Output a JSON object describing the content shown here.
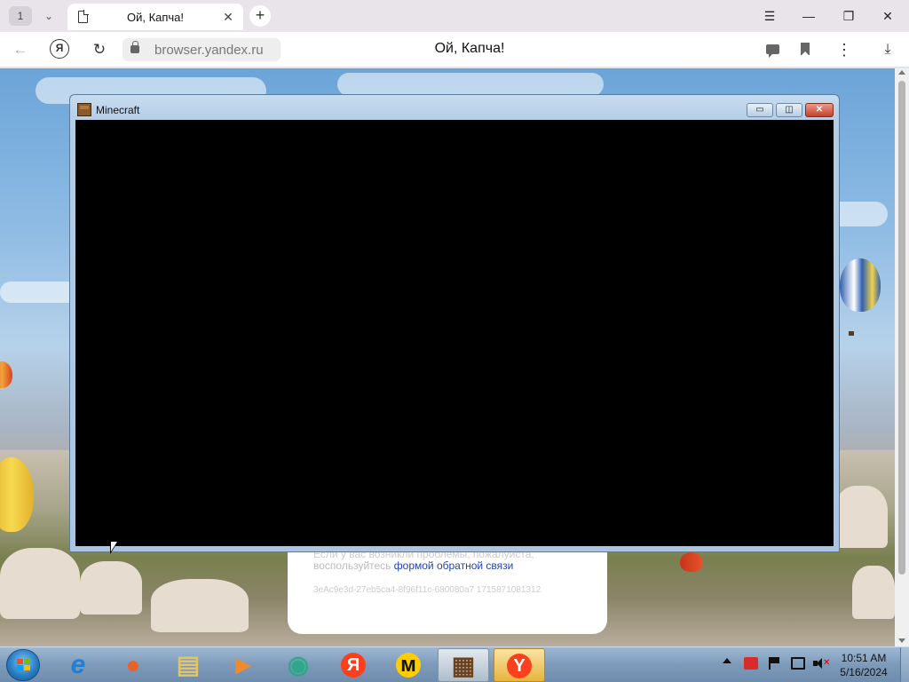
{
  "browser": {
    "tab_counter": "1",
    "tab_title": "Ой, Капча!",
    "url": "browser.yandex.ru",
    "page_title": "Ой, Капча!",
    "window_controls": {
      "menu": "☰",
      "minimize": "—",
      "restore": "❐",
      "close": "✕"
    },
    "nav_glyphs": {
      "back": "←",
      "reload": "↻",
      "yandex": "Я",
      "new_tab": "+",
      "tab_close": "✕",
      "tab_list": "⌄",
      "menu": "⋮",
      "download": "⤓"
    }
  },
  "captcha": {
    "line1_faded": "Если у вас возникли проблемы, пожалуйста,",
    "line2_prefix": "воспользуйтесь",
    "feedback_link": "формой обратной связи",
    "request_id": "3eAc9e3d-27eb5ca4-8f96f11c-680080a7 1715871081312"
  },
  "minecraft_window": {
    "title": "Minecraft",
    "controls": {
      "minimize": "▭",
      "maximize": "◫",
      "close": "✕"
    }
  },
  "taskbar": {
    "apps": [
      {
        "name": "internet-explorer",
        "glyph": "e",
        "color": "#1e7fd6"
      },
      {
        "name": "firefox",
        "glyph": "●",
        "color": "#e8622c"
      },
      {
        "name": "file-explorer",
        "glyph": "▤",
        "color": "#e8c45a"
      },
      {
        "name": "media-player",
        "glyph": "▶",
        "color": "#f08a2a"
      },
      {
        "name": "messenger",
        "glyph": "◉",
        "color": "#2fa88a"
      },
      {
        "name": "yandex",
        "glyph": "Я",
        "color": "#ffffff"
      },
      {
        "name": "yandex-market",
        "glyph": "м",
        "color": "#111111"
      },
      {
        "name": "minecraft-launcher",
        "glyph": "▦",
        "color": "#6b4320"
      },
      {
        "name": "yandex-browser",
        "glyph": "Y",
        "color": "#ffffff"
      }
    ],
    "clock_time": "10:51 AM",
    "clock_date": "5/16/2024"
  }
}
